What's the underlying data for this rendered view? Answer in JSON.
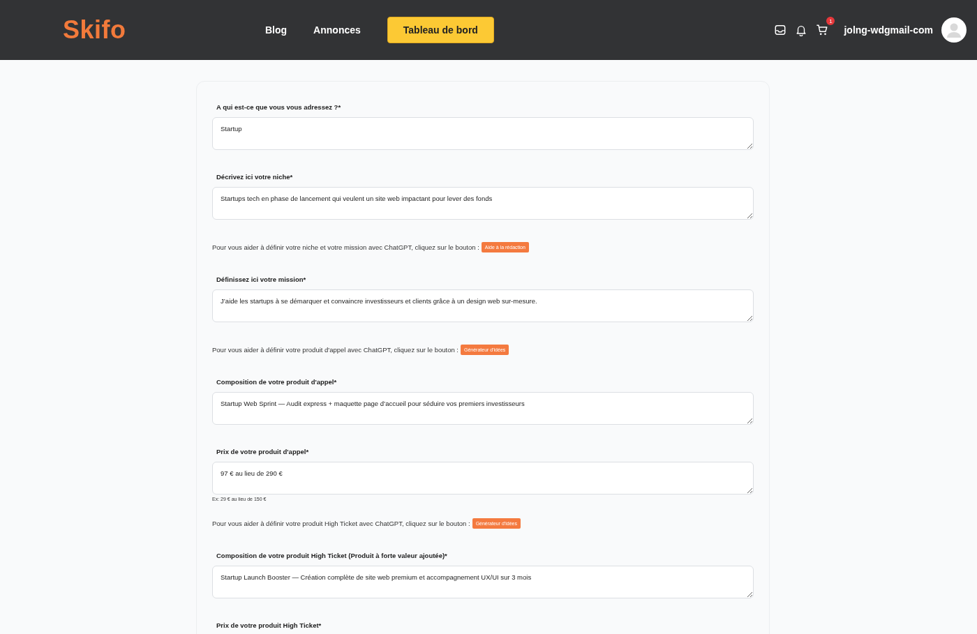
{
  "header": {
    "logo": "Skifo",
    "nav": [
      {
        "label": "Blog",
        "selected": false
      },
      {
        "label": "Annonces",
        "selected": false
      },
      {
        "label": "Tableau de bord",
        "selected": true
      }
    ],
    "cart_badge": "1",
    "username": "jolng-wdgmail-com"
  },
  "form": [
    {
      "kind": "field",
      "label": "A qui est-ce que vous vous adressez ?*",
      "value": "Startup"
    },
    {
      "kind": "field",
      "label": "Décrivez ici votre niche*",
      "value": "Startups tech en phase de lancement qui veulent un site web impactant pour lever des fonds"
    },
    {
      "kind": "helper",
      "text": "Pour vous aider à définir votre niche et votre mission avec ChatGPT, cliquez sur le bouton :",
      "button": "Aide à la rédaction"
    },
    {
      "kind": "field",
      "label": "Définissez ici votre mission*",
      "value": "J’aide les startups à se démarquer et convaincre investisseurs et clients grâce à un design web sur-mesure."
    },
    {
      "kind": "helper",
      "text": "Pour vous aider à définir votre produit d'appel avec ChatGPT, cliquez sur le bouton :",
      "button": "Générateur d'idées"
    },
    {
      "kind": "field",
      "label": "Composition de votre produit d'appel*",
      "value": "Startup Web Sprint — Audit express + maquette page d’accueil pour séduire vos premiers investisseurs"
    },
    {
      "kind": "field",
      "label": "Prix de votre produit d'appel*",
      "value": "97 € au lieu de 290 €",
      "hint": "Ex: 29 € au lieu de 150 €"
    },
    {
      "kind": "helper",
      "text": "Pour vous aider à définir votre produit High Ticket avec ChatGPT, cliquez sur le bouton :",
      "button": "Générateur d'idées"
    },
    {
      "kind": "field",
      "label": "Composition de votre produit High Ticket (Produit à forte valeur ajoutée)*",
      "value": "Startup Launch Booster — Création complète de site web premium et accompagnement UX/UI sur 3 mois"
    },
    {
      "kind": "label",
      "label": "Prix de votre produit High Ticket*"
    }
  ]
}
